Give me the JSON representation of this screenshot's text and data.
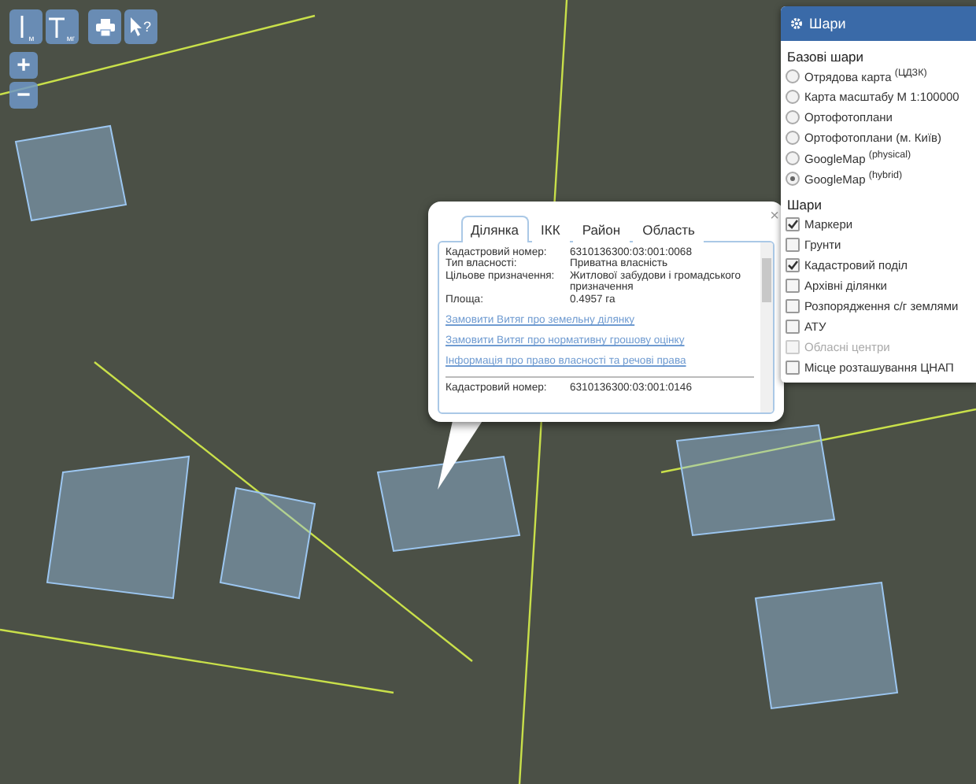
{
  "toolbar": {
    "groups": [
      [
        {
          "kind": "distance",
          "label": "м"
        },
        {
          "kind": "area",
          "label": "мг"
        }
      ],
      [
        {
          "kind": "print"
        },
        {
          "kind": "info",
          "label": "?"
        }
      ]
    ]
  },
  "zoom": {
    "in": "+",
    "out": "−"
  },
  "layers_panel": {
    "title": "Шари",
    "base_title": "Базові шари",
    "base_layers": [
      {
        "label": "Отрядова карта $^{(ЦДЗК)}$",
        "selected": false
      },
      {
        "label": "Карта масштабу М 1:100000",
        "selected": false
      },
      {
        "label": "Ортофотоплани",
        "selected": false
      },
      {
        "label": "Ортофотоплани (м. Київ)",
        "selected": false
      },
      {
        "label": "GoogleMap $^{(physical)}$",
        "selected": false
      },
      {
        "label": "GoogleMap $^{(hybrid)}$",
        "selected": true
      }
    ],
    "overlay_title": "Шари",
    "overlays": [
      {
        "label": "Маркери",
        "checked": true,
        "disabled": false
      },
      {
        "label": "Грунти",
        "checked": false,
        "disabled": false
      },
      {
        "label": "Кадастровий поділ",
        "checked": true,
        "disabled": false
      },
      {
        "label": "Архівні ділянки",
        "checked": false,
        "disabled": false
      },
      {
        "label": "Розпорядження с/г землями",
        "checked": false,
        "disabled": false
      },
      {
        "label": "АТУ",
        "checked": false,
        "disabled": false
      },
      {
        "label": "Обласні центри",
        "checked": false,
        "disabled": true
      },
      {
        "label": "Місце розташування ЦНАП",
        "checked": false,
        "disabled": false
      }
    ]
  },
  "popup": {
    "close": "×",
    "tabs": [
      {
        "label": "Ділянка",
        "selected": true
      },
      {
        "label": "ІКК",
        "selected": false
      },
      {
        "label": "Район",
        "selected": false
      },
      {
        "label": "Область",
        "selected": false
      }
    ],
    "fields": [
      {
        "label": "Кадастровий номер:",
        "value": "6310136300:03:001:0068"
      },
      {
        "label": "Тип власності:",
        "value": "Приватна власність"
      },
      {
        "label": "Цільове призначення:",
        "value": "Житлової забудови і громадського призначення"
      },
      {
        "label": "Площа:",
        "value": "0.4957 га"
      }
    ],
    "links": [
      "Замовити Витяг про земельну ділянку",
      "Замовити Витяг про нормативну грошову оцінку",
      "Інформація про право власності та речові права"
    ],
    "next_field": {
      "label": "Кадастровий номер:",
      "value": "6310136300:03:001:0146"
    }
  }
}
